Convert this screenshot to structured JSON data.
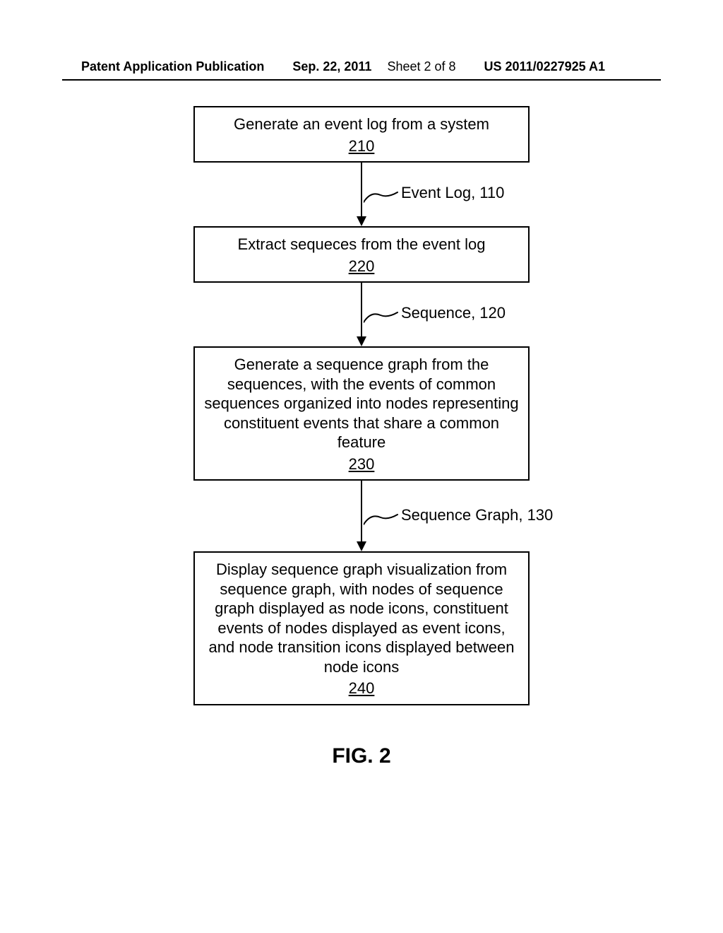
{
  "header": {
    "pub": "Patent Application Publication",
    "date": "Sep. 22, 2011",
    "sheet": "Sheet 2 of 8",
    "num": "US 2011/0227925 A1"
  },
  "boxes": {
    "b1": {
      "text": "Generate an event log from a system",
      "ref": "210"
    },
    "b2": {
      "text": "Extract sequeces from the event log",
      "ref": "220"
    },
    "b3": {
      "text": "Generate a sequence graph from the sequences, with the events of common sequences organized into nodes representing constituent events that share a common feature",
      "ref": "230"
    },
    "b4": {
      "text": "Display sequence graph visualization from sequence graph, with nodes of sequence graph displayed as node icons, constituent events of nodes displayed as event icons, and node transition icons displayed between node icons",
      "ref": "240"
    }
  },
  "labels": {
    "l1": "Event Log, 110",
    "l2": "Sequence, 120",
    "l3": "Sequence Graph, 130"
  },
  "figure": "FIG. 2"
}
